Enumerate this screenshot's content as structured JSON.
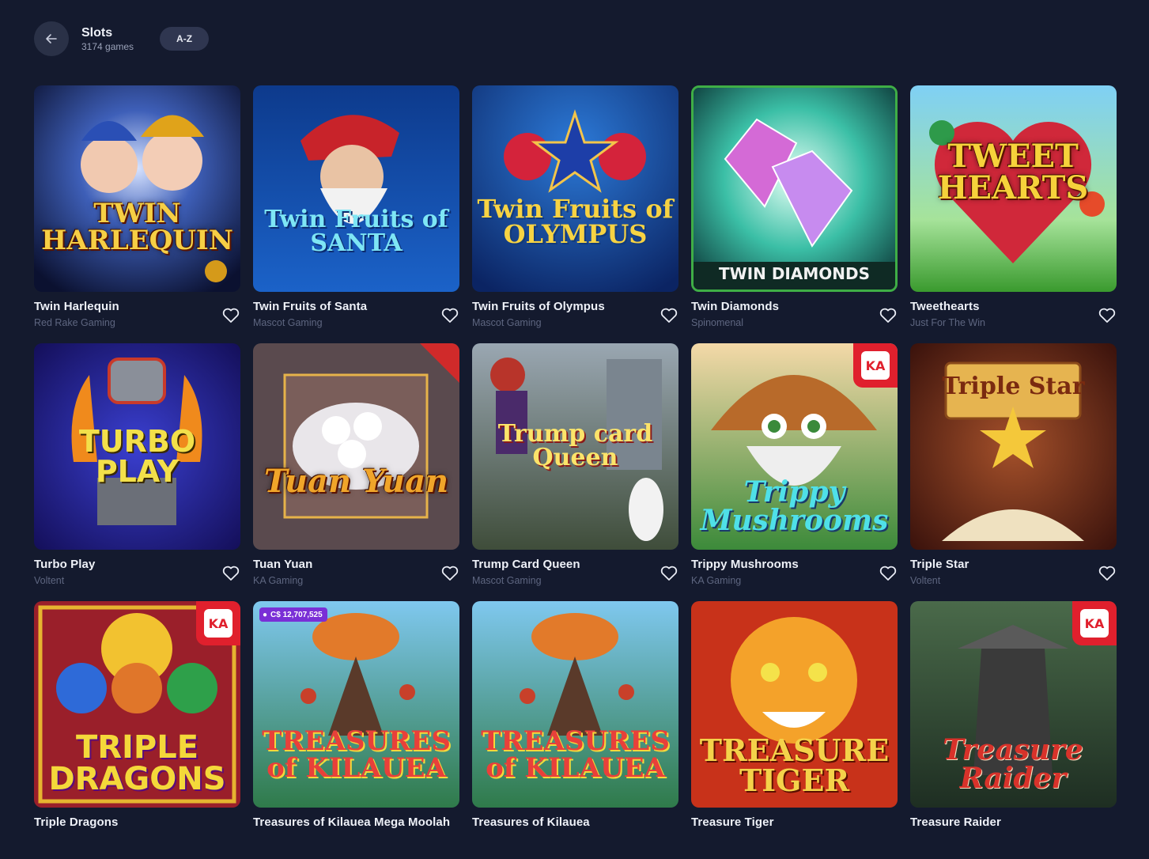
{
  "header": {
    "title": "Slots",
    "count": "3174 games",
    "sort_label": "A-Z"
  },
  "colors": {
    "background": "#141a2e",
    "button_bg": "#2a3147",
    "provider_text": "#5e6680"
  },
  "games": [
    {
      "name": "Twin Harlequin",
      "provider": "Red Rake Gaming",
      "art": "TWIN HARLEQUIN"
    },
    {
      "name": "Twin Fruits of Santa",
      "provider": "Mascot Gaming",
      "art": "Twin Fruits of SANTA"
    },
    {
      "name": "Twin Fruits of Olympus",
      "provider": "Mascot Gaming",
      "art": "Twin Fruits of OLYMPUS"
    },
    {
      "name": "Twin Diamonds",
      "provider": "Spinomenal",
      "art": "TWIN DIAMONDS"
    },
    {
      "name": "Tweethearts",
      "provider": "Just For The Win",
      "art": "TWEET HEARTS"
    },
    {
      "name": "Turbo Play",
      "provider": "Voltent",
      "art": "TURBO PLAY"
    },
    {
      "name": "Tuan Yuan",
      "provider": "KA Gaming",
      "art": "Tuan Yuan"
    },
    {
      "name": "Trump Card Queen",
      "provider": "Mascot Gaming",
      "art": "Trump card Queen"
    },
    {
      "name": "Trippy Mushrooms",
      "provider": "KA Gaming",
      "art": "Trippy Mushrooms"
    },
    {
      "name": "Triple Star",
      "provider": "Voltent",
      "art": "Triple Star"
    },
    {
      "name": "Triple Dragons",
      "provider": "",
      "art": "TRIPLE DRAGONS"
    },
    {
      "name": "Treasures of Kilauea Mega Moolah",
      "provider": "",
      "art": "TREASURES of KILAUEA",
      "jackpot": "C$ 12,707,525"
    },
    {
      "name": "Treasures of Kilauea",
      "provider": "",
      "art": "TREASURES of KILAUEA"
    },
    {
      "name": "Treasure Tiger",
      "provider": "",
      "art": "TREASURE TIGER"
    },
    {
      "name": "Treasure Raider",
      "provider": "",
      "art": "Treasure Raider"
    }
  ]
}
